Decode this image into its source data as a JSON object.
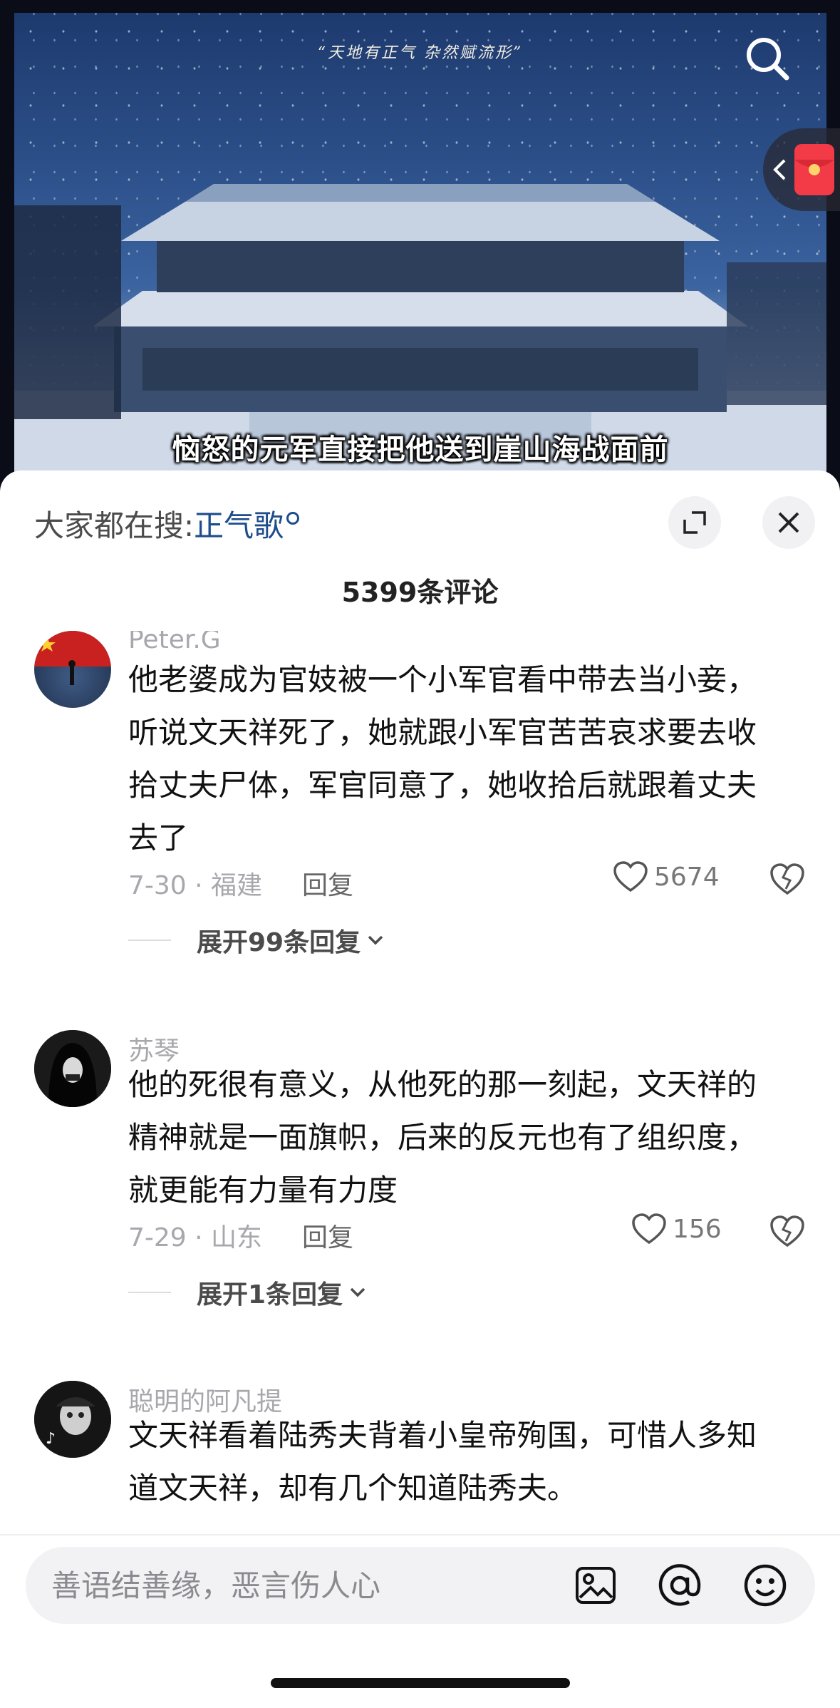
{
  "video": {
    "overlay_text": "“天地有正气 杂然赋流形”",
    "subtitle": "恼怒的元军直接把他送到崖山海战面前"
  },
  "sheet": {
    "hot_search_prefix": "大家都在搜:",
    "hot_search_keyword": "正气歌",
    "comment_count": "5399条评论"
  },
  "comments": [
    {
      "username": "Peter.G",
      "text": "他老婆成为官妓被一个小军官看中带去当小妾，听说文天祥死了，她就跟小军官苦苦哀求要去收拾丈夫尸体，军官同意了，她收拾后就跟着丈夫去了",
      "meta": "7-30 · 福建",
      "reply_label": "回复",
      "likes": "5674",
      "expand_label": "展开99条回复"
    },
    {
      "username": "苏琴",
      "text": "他的死很有意义，从他死的那一刻起，文天祥的精神就是一面旗帜，后来的反元也有了组织度，就更能有力量有力度",
      "meta": "7-29 · 山东",
      "reply_label": "回复",
      "likes": "156",
      "expand_label": "展开1条回复"
    },
    {
      "username": "聪明的阿凡提",
      "text": "文天祥看着陆秀夫背着小皇帝殉国，可惜人多知道文天祥，却有几个知道陆秀夫。"
    }
  ],
  "input": {
    "placeholder": "善语结善缘，恶言伤人心"
  },
  "icons": {
    "search": "search-icon",
    "red_packet": "red-packet-icon",
    "expand": "fullscreen-icon",
    "close": "close-icon",
    "like": "heart-icon",
    "dislike": "broken-heart-icon",
    "image": "image-icon",
    "mention": "at-icon",
    "emoji": "emoji-icon"
  }
}
